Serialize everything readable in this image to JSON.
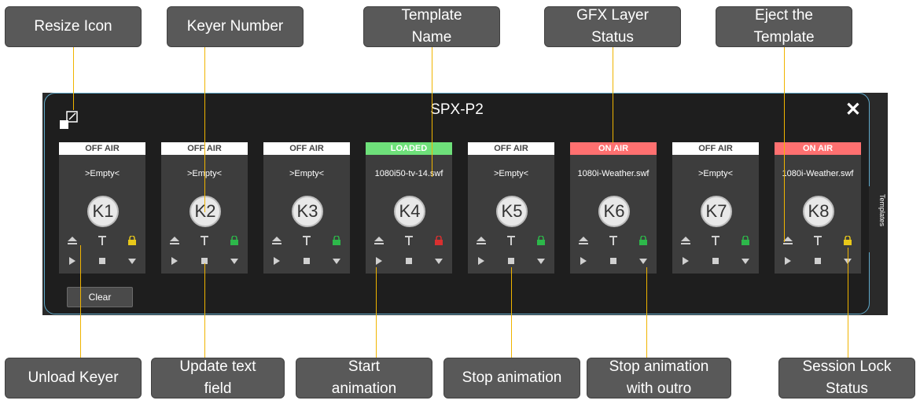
{
  "callouts": {
    "resize_icon": "Resize Icon",
    "keyer_number": "Keyer Number",
    "template_name": "Template\nName",
    "gfx_layer_status": "GFX Layer\nStatus",
    "eject_template": "Eject the\nTemplate",
    "unload_keyer": "Unload Keyer",
    "update_text": "Update text\nfield",
    "start_animation": "Start\nanimation",
    "stop_animation": "Stop animation",
    "stop_outro": "Stop animation\nwith outro",
    "session_lock": "Session Lock\nStatus"
  },
  "window": {
    "title": "SPX-P2",
    "side_tab": "Templates",
    "clear_label": "Clear"
  },
  "colors": {
    "off_air": "#ffffff",
    "loaded": "#6ee07a",
    "on_air": "#ff7070"
  },
  "keyers": [
    {
      "status": "OFF AIR",
      "status_type": "off_air",
      "template": ">Empty<",
      "label": "K1",
      "lock": "yellow"
    },
    {
      "status": "OFF AIR",
      "status_type": "off_air",
      "template": ">Empty<",
      "label": "K2",
      "lock": "green"
    },
    {
      "status": "OFF AIR",
      "status_type": "off_air",
      "template": ">Empty<",
      "label": "K3",
      "lock": "green"
    },
    {
      "status": "LOADED",
      "status_type": "loaded",
      "template": "1080i50-tv-14.swf",
      "label": "K4",
      "lock": "red"
    },
    {
      "status": "OFF AIR",
      "status_type": "off_air",
      "template": ">Empty<",
      "label": "K5",
      "lock": "green"
    },
    {
      "status": "ON AIR",
      "status_type": "on_air",
      "template": "1080i-Weather.swf",
      "label": "K6",
      "lock": "green"
    },
    {
      "status": "OFF AIR",
      "status_type": "off_air",
      "template": ">Empty<",
      "label": "K7",
      "lock": "green"
    },
    {
      "status": "ON AIR",
      "status_type": "on_air",
      "template": "1080i-Weather.swf",
      "label": "K8",
      "lock": "yellow"
    }
  ]
}
